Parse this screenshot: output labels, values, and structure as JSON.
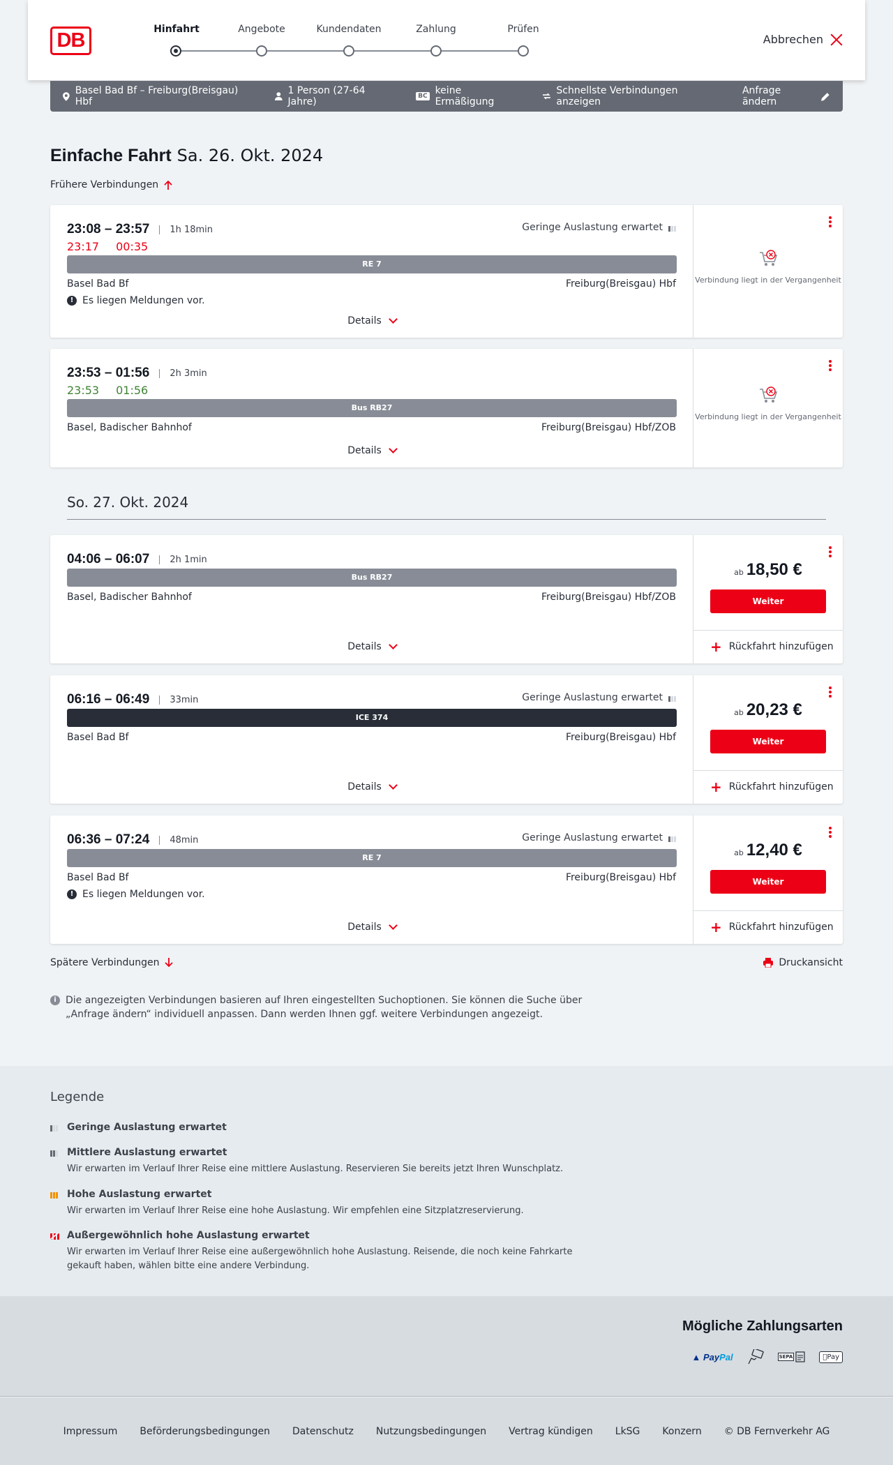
{
  "header": {
    "logo_text": "DB",
    "steps": [
      "Hinfahrt",
      "Angebote",
      "Kundendaten",
      "Zahlung",
      "Prüfen"
    ],
    "cancel_label": "Abbrechen"
  },
  "summary": {
    "route": "Basel Bad Bf – Freiburg(Breisgau) Hbf",
    "passengers": "1 Person (27-64 Jahre)",
    "discount_badge": "BC",
    "discount": "keine Ermäßigung",
    "option": "Schnellste Verbindungen anzeigen",
    "change_label": "Anfrage ändern"
  },
  "page": {
    "title_type": "Einfache Fahrt",
    "title_date": "Sa. 26. Okt. 2024",
    "earlier_label": "Frühere Verbindungen",
    "later_label": "Spätere Verbindungen",
    "print_label": "Druckansicht",
    "day2_header": "So. 27. Okt. 2024",
    "info_note": "Die angezeigten Verbindungen basieren auf Ihren eingestellten Suchoptionen. Sie können die Suche über „Anfrage ändern“ individuell anpassen. Dann werden Ihnen ggf. weitere Verbindungen angezeigt."
  },
  "connections": [
    {
      "times": "23:08 – 23:57",
      "duration": "1h 18min",
      "rt_dep": "23:17",
      "rt_arr": "00:35",
      "load": "Geringe Auslastung erwartet",
      "train": "RE 7",
      "from": "Basel Bad Bf",
      "to": "Freiburg(Breisgau) Hbf",
      "message": "Es liegen Meldungen vor.",
      "details": "Details",
      "status": "Verbindung liegt in der Vergangenheit"
    },
    {
      "times": "23:53 – 01:56",
      "duration": "2h 3min",
      "rt_dep": "23:53",
      "rt_arr": "01:56",
      "train": "Bus RB27",
      "from": "Basel, Badischer Bahnhof",
      "to": "Freiburg(Breisgau) Hbf/ZOB",
      "details": "Details",
      "status": "Verbindung liegt in der Vergangenheit"
    },
    {
      "times": "04:06 – 06:07",
      "duration": "2h 1min",
      "train": "Bus RB27",
      "from": "Basel, Badischer Bahnhof",
      "to": "Freiburg(Breisgau) Hbf/ZOB",
      "details": "Details",
      "price_prefix": "ab",
      "price": "18,50 €",
      "button": "Weiter",
      "return_label": "Rückfahrt hinzufügen"
    },
    {
      "times": "06:16 – 06:49",
      "duration": "33min",
      "load": "Geringe Auslastung erwartet",
      "train": "ICE 374",
      "from": "Basel Bad Bf",
      "to": "Freiburg(Breisgau) Hbf",
      "details": "Details",
      "price_prefix": "ab",
      "price": "20,23 €",
      "button": "Weiter",
      "return_label": "Rückfahrt hinzufügen"
    },
    {
      "times": "06:36 – 07:24",
      "duration": "48min",
      "load": "Geringe Auslastung erwartet",
      "train": "RE 7",
      "from": "Basel Bad Bf",
      "to": "Freiburg(Breisgau) Hbf",
      "message": "Es liegen Meldungen vor.",
      "details": "Details",
      "price_prefix": "ab",
      "price": "12,40 €",
      "button": "Weiter",
      "return_label": "Rückfahrt hinzufügen"
    }
  ],
  "legend": {
    "title": "Legende",
    "items": [
      {
        "title": "Geringe Auslastung erwartet",
        "text": ""
      },
      {
        "title": "Mittlere Auslastung erwartet",
        "text": "Wir erwarten im Verlauf Ihrer Reise eine mittlere Auslastung. Reservieren Sie bereits jetzt Ihren Wunschplatz."
      },
      {
        "title": "Hohe Auslastung erwartet",
        "text": "Wir erwarten im Verlauf Ihrer Reise eine hohe Auslastung. Wir empfehlen eine Sitzplatzreservierung."
      },
      {
        "title": "Außergewöhnlich hohe Auslastung erwartet",
        "text": "Wir erwarten im Verlauf Ihrer Reise eine außergewöhnlich hohe Auslastung. Reisende, die noch keine Fahrkarte gekauft haben, wählen bitte eine andere Verbindung."
      }
    ]
  },
  "payment": {
    "title": "Mögliche Zahlungsarten",
    "paypal_a": "Pay",
    "paypal_b": "Pal",
    "sepa": "SEPA",
    "applepay": "Pay"
  },
  "footer": [
    "Impressum",
    "Beförderungsbedingungen",
    "Datenschutz",
    "Nutzungsbedingungen",
    "Vertrag kündigen",
    "LkSG",
    "Konzern",
    "© DB Fernverkehr AG"
  ],
  "colors": {
    "accent": "#ec0016",
    "late": "#ec0016",
    "ontime": "#408335",
    "bar": "#878c96",
    "ice_bar": "#282d37"
  }
}
